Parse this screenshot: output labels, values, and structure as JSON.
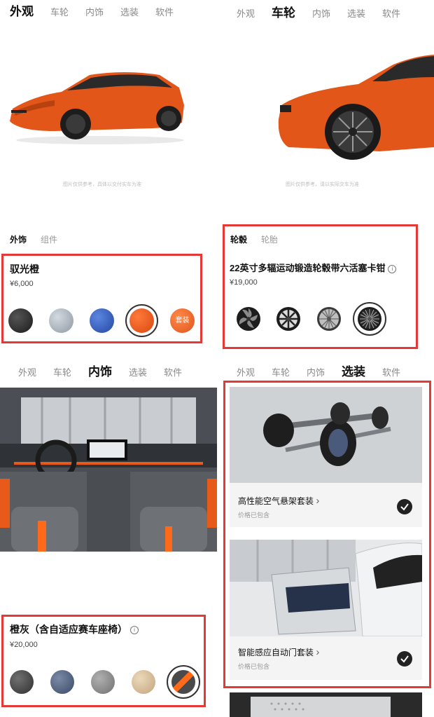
{
  "panel1": {
    "tabs": [
      "外观",
      "车轮",
      "内饰",
      "选装",
      "软件"
    ],
    "disclaimer": "图片仅供参考，具体以交付实车为准",
    "subtabs": [
      "外饰",
      "组件"
    ],
    "title": "驭光橙",
    "price": "¥6,000",
    "badge": "套装",
    "colors": [
      "#2b2b2b",
      "#a9b3bd",
      "#2f62c6",
      "#ee5a1b",
      "#f06a22"
    ]
  },
  "panel2": {
    "tabs": [
      "外观",
      "车轮",
      "内饰",
      "选装",
      "软件"
    ],
    "disclaimer": "图片仅供参考，请以实际交车为准",
    "subtabs": [
      "轮毂",
      "轮胎"
    ],
    "title": "22英寸多辐运动锻造轮毂带六活塞卡钳",
    "price": "¥19,000",
    "info_icon": "info-icon"
  },
  "panel3": {
    "tabs": [
      "外观",
      "车轮",
      "内饰",
      "选装",
      "软件"
    ],
    "title": "橙灰（含自适应赛车座椅）",
    "price": "¥20,000",
    "info_icon": "info-icon",
    "colors": [
      "#4a4a4a",
      "#4d5f7c",
      "#8c8c8c",
      "#d9c2a0",
      "#5c5c5c"
    ]
  },
  "panel4": {
    "tabs": [
      "外观",
      "车轮",
      "内饰",
      "选装",
      "软件"
    ],
    "cards": [
      {
        "title": "高性能空气悬架套装",
        "chevron": "›",
        "sub": "价格已包含"
      },
      {
        "title": "智能感应自动门套装",
        "chevron": "›",
        "sub": "价格已包含"
      }
    ]
  },
  "colors": {
    "accent": "#ee5a1b",
    "highlight_box": "#e53935",
    "active_tab": "#111111",
    "inactive_tab": "#8a8a8a"
  }
}
